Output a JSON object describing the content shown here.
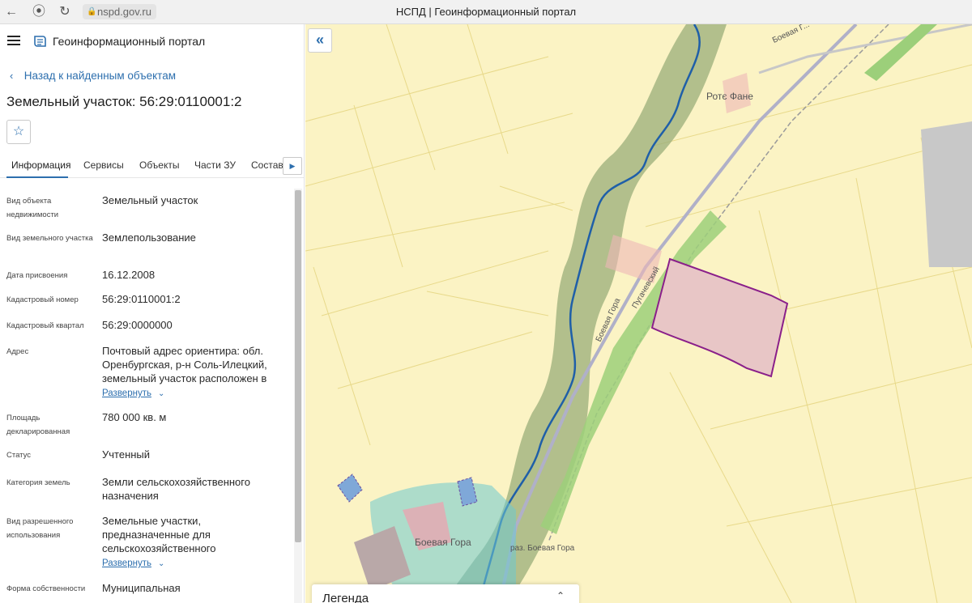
{
  "browser": {
    "url": "nspd.gov.ru",
    "tab_title": "НСПД | Геоинформационный портал"
  },
  "header": {
    "title": "Геоинформационный портал"
  },
  "nav": {
    "back_label": "Назад к найденным объектам"
  },
  "object": {
    "title": "Земельный участок: 56:29:0110001:2"
  },
  "tabs": [
    {
      "label": "Информация",
      "active": true
    },
    {
      "label": "Сервисы"
    },
    {
      "label": "Объекты"
    },
    {
      "label": "Части ЗУ"
    },
    {
      "label": "Состав"
    }
  ],
  "properties": [
    {
      "label": "Вид объекта недвижимости",
      "value": "Земельный участок"
    },
    {
      "label": "Вид земельного участка",
      "value": "Землепользование"
    },
    {
      "label": "Дата присвоения",
      "value": "16.12.2008"
    },
    {
      "label": "Кадастровый номер",
      "value": "56:29:0110001:2"
    },
    {
      "label": "Кадастровый квартал",
      "value": "56:29:0000000"
    },
    {
      "label": "Адрес",
      "value": "Почтовый адрес ориентира: обл. Оренбургская, р-н Соль-Илецкий, земельный участок расположен в",
      "expand": "Развернуть"
    },
    {
      "label": "Площадь декларированная",
      "value": "780 000 кв. м"
    },
    {
      "label": "Статус",
      "value": "Учтенный"
    },
    {
      "label": "Категория земель",
      "value": "Земли сельскохозяйственного назначения"
    },
    {
      "label": "Вид разрешенного использования",
      "value": "Земельные участки, предназначенные для сельскохозяйственного",
      "expand": "Развернуть"
    },
    {
      "label": "Форма собственности",
      "value": "Муниципальная"
    }
  ],
  "map": {
    "labels": {
      "settlement_1": "Ротє Фане",
      "settlement_2": "Боевая Гора",
      "station": "раз. Боевая Гора",
      "road_1": "Пугачевский",
      "road_2": "Боевая Гора",
      "road_3": "Боевая Г..."
    },
    "legend_title": "Легенда",
    "colors": {
      "background": "#fbf3c4",
      "selected_parcel_fill": "#e8c6c6",
      "selected_parcel_stroke": "#8a1f8a",
      "river": "#1f5fa8",
      "floodplain": "#9aae7a",
      "green_strip": "#9ccf7a",
      "industrial": "#c8c8c8"
    }
  }
}
